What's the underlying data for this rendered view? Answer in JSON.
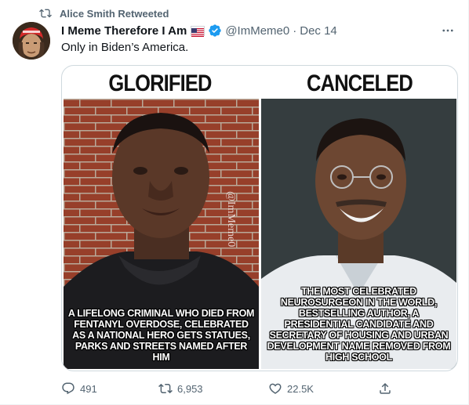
{
  "social_context": {
    "text": "Alice Smith Retweeted"
  },
  "author": {
    "display_name": "I Meme Therefore I Am",
    "handle": "@ImMeme0",
    "separator": "·",
    "date": "Dec 14"
  },
  "tweet": {
    "text": "Only in Biden’s America."
  },
  "meme": {
    "left_title": "GLORIFIED",
    "right_title": "CANCELED",
    "watermark": "@ImMeme0",
    "left_caption": "A lifelong criminal who died from fentanyl overdose, celebrated as a national hero gets statues, parks and streets named after him",
    "right_caption": "The most celebrated neurosurgeon in the world, bestselling author, a presidential candidate and secretary of housing and urban development name removed from high school"
  },
  "actions": {
    "replies": "491",
    "retweets": "6,953",
    "likes": "22.5K"
  },
  "colors": {
    "text_primary": "#0f1419",
    "text_secondary": "#536471",
    "verified_blue": "#1d9bf0",
    "border": "#cfd9de"
  },
  "icons": {
    "retweet": "retweet-icon",
    "verified": "verified-badge-icon",
    "flag": "us-flag-icon",
    "more": "more-options-icon",
    "reply": "reply-icon",
    "like": "heart-icon",
    "share": "share-icon"
  }
}
